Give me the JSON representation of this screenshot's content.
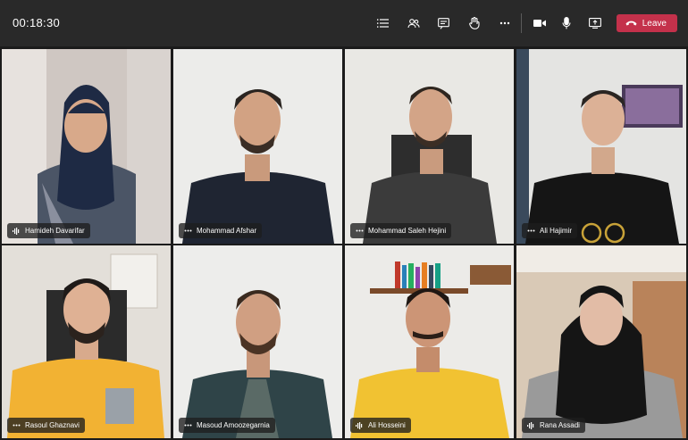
{
  "meeting": {
    "timer": "00:18:30",
    "leave_label": "Leave",
    "accent_leave": "#c4314b"
  },
  "toolbar": {
    "icons": [
      "list-icon",
      "people-icon",
      "chat-icon",
      "raise-hand-icon",
      "more-icon",
      "camera-icon",
      "microphone-icon",
      "share-screen-icon",
      "hang-up-icon"
    ]
  },
  "participants": [
    {
      "name": "Hamideh Davarifar",
      "indicator": "speaking"
    },
    {
      "name": "Mohammad Afshar",
      "indicator": "more"
    },
    {
      "name": "Mohammad Saleh Hejini",
      "indicator": "more"
    },
    {
      "name": "Ali Hajimir",
      "indicator": "more"
    },
    {
      "name": "Rasoul Ghaznavi",
      "indicator": "more"
    },
    {
      "name": "Masoud Amoozegarnia",
      "indicator": "more"
    },
    {
      "name": "Ali Hosseini",
      "indicator": "speaking"
    },
    {
      "name": "Rana Assadi",
      "indicator": "speaking"
    }
  ]
}
